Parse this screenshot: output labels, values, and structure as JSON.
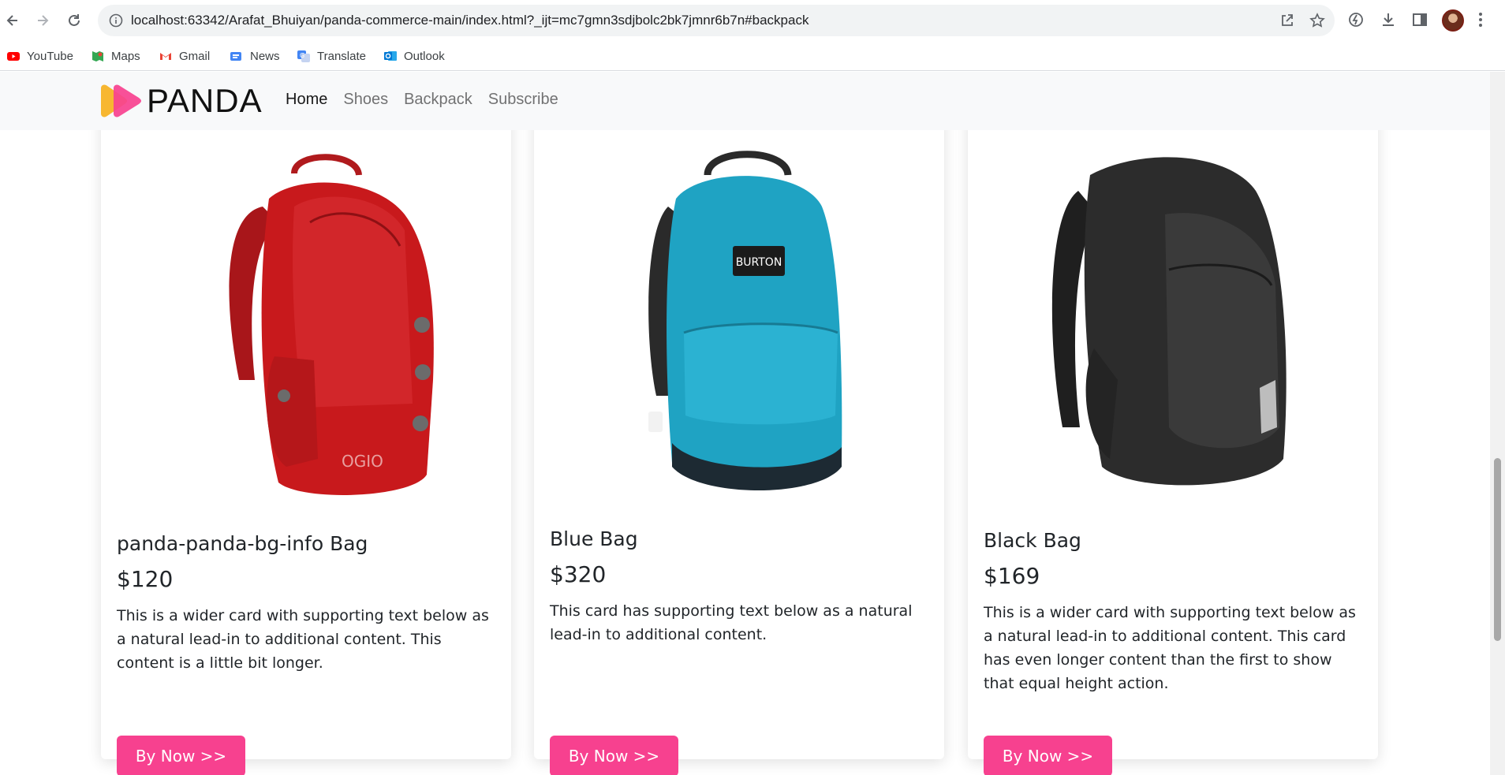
{
  "browser": {
    "url": "localhost:63342/Arafat_Bhuiyan/panda-commerce-main/index.html?_ijt=mc7gmn3sdjbolc2bk7jmnr6b7n#backpack",
    "bookmarks": [
      {
        "label": "YouTube",
        "icon": "youtube-icon"
      },
      {
        "label": "Maps",
        "icon": "maps-icon"
      },
      {
        "label": "Gmail",
        "icon": "gmail-icon"
      },
      {
        "label": "News",
        "icon": "news-icon"
      },
      {
        "label": "Translate",
        "icon": "translate-icon"
      },
      {
        "label": "Outlook",
        "icon": "outlook-icon"
      }
    ]
  },
  "site": {
    "brand": "PANDA",
    "nav": [
      {
        "label": "Home",
        "active": true
      },
      {
        "label": "Shoes",
        "active": false
      },
      {
        "label": "Backpack",
        "active": false
      },
      {
        "label": "Subscribe",
        "active": false
      }
    ],
    "accent_color": "#f7418f"
  },
  "products": [
    {
      "title": "panda-panda-bg-info Bag",
      "price": "$120",
      "description": "This is a wider card with supporting text below as a natural lead-in to additional content. This content is a little bit longer.",
      "button": "By Now >>",
      "color": "#c8191c",
      "brand_mark": "OGIO"
    },
    {
      "title": "Blue Bag",
      "price": "$320",
      "description": "This card has supporting text below as a natural lead-in to additional content.",
      "button": "By Now >>",
      "color": "#1fa3c3",
      "brand_mark": "BURTON"
    },
    {
      "title": "Black Bag",
      "price": "$169",
      "description": "This is a wider card with supporting text below as a natural lead-in to additional content. This card has even longer content than the first to show that equal height action.",
      "button": "By Now >>",
      "color": "#2c2c2c",
      "brand_mark": ""
    }
  ]
}
